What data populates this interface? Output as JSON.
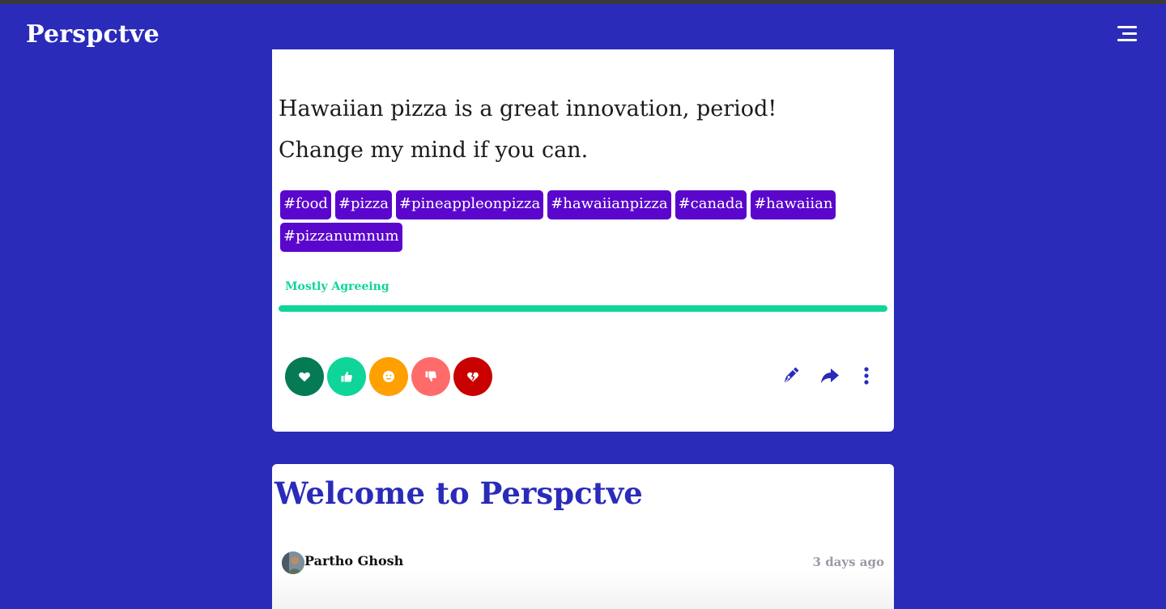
{
  "app": {
    "brand": "Perspctve"
  },
  "post": {
    "statement": "Hawaiian pizza is a great innovation, period! Change my mind if you can.",
    "tags": [
      "#food",
      "#pizza",
      "#pineappleonpizza",
      "#hawaiianpizza",
      "#canada",
      "#hawaiian",
      "#pizzanumnum"
    ],
    "sentiment_label": "Mostly Agreeing",
    "sentiment_progress_percent": 100,
    "reactions": [
      {
        "name": "love",
        "icon": "heart-icon",
        "color": "#057a55"
      },
      {
        "name": "agree",
        "icon": "thumbs-up-icon",
        "color": "#0fd59a"
      },
      {
        "name": "neutral",
        "icon": "neutral-face-icon",
        "color": "#ff9f00"
      },
      {
        "name": "disagree",
        "icon": "thumbs-down-icon",
        "color": "#ff6b6b"
      },
      {
        "name": "hate",
        "icon": "broken-heart-icon",
        "color": "#c80000"
      }
    ],
    "actions": [
      "pen-icon",
      "share-icon",
      "more-vertical-icon"
    ]
  },
  "next_post": {
    "title": "Welcome to Perspctve",
    "author": "Partho Ghosh",
    "time": "3 days ago"
  },
  "colors": {
    "brand": "#2a2bb9",
    "tag": "#5a06cc",
    "agree": "#0fd59a"
  }
}
